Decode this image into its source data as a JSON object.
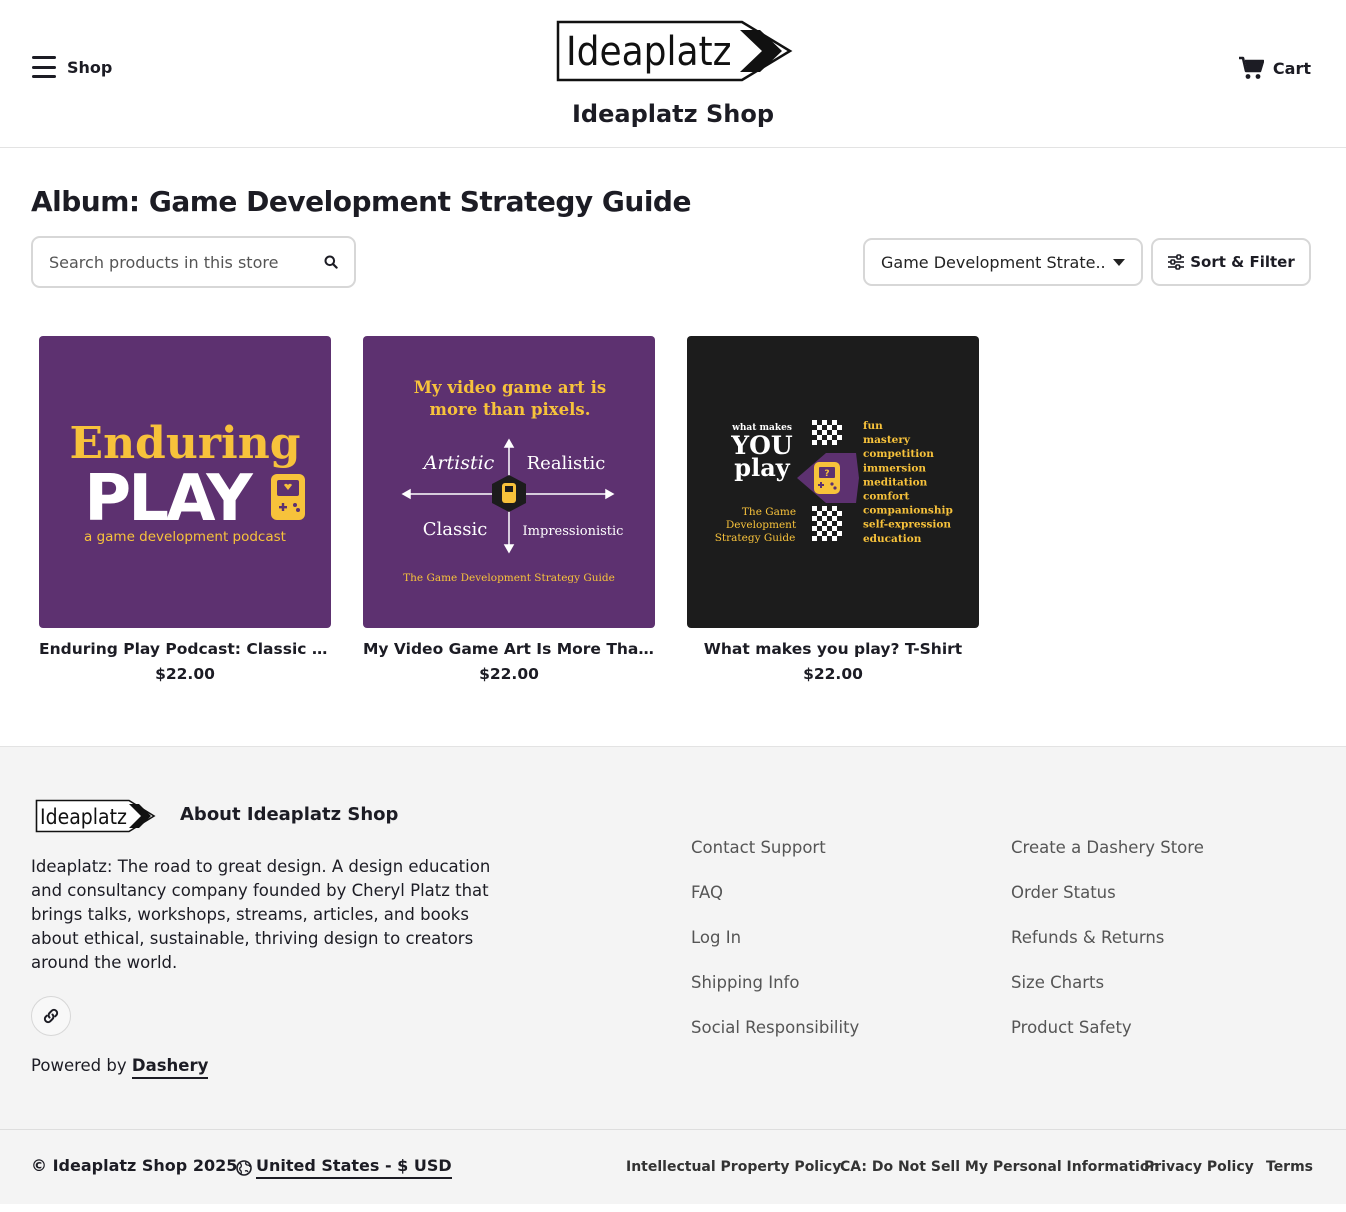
{
  "header": {
    "menu_label": "Shop",
    "logo_text": "Ideaplatz",
    "shop_title": "Ideaplatz Shop",
    "cart_label": "Cart"
  },
  "main": {
    "album_title": "Album: Game Development Strategy Guide",
    "search_placeholder": "Search products in this store",
    "album_select_value": "Game Development Strate...",
    "sort_filter_label": "Sort & Filter"
  },
  "products": [
    {
      "name": "Enduring Play Podcast: Classic Lo...",
      "price": "$22.00",
      "art": {
        "line1": "Enduring",
        "line2": "PLAY",
        "line3": "a game development podcast"
      }
    },
    {
      "name": "My Video Game Art Is More Than ...",
      "price": "$22.00",
      "art": {
        "headline1": "My video game art is",
        "headline2": "more than pixels.",
        "q_artistic": "Artistic",
        "q_realistic": "Realistic",
        "q_classic": "Classic",
        "q_impressionistic": "Impressionistic",
        "footer": "The Game Development Strategy Guide"
      }
    },
    {
      "name": "What makes you play? T-Shirt",
      "price": "$22.00",
      "art": {
        "small": "what makes",
        "you": "YOU",
        "play": "play",
        "guide1": "The Game",
        "guide2": "Development",
        "guide3": "Strategy Guide",
        "words": [
          "fun",
          "mastery",
          "competition",
          "immersion",
          "meditation",
          "comfort",
          "companionship",
          "self-expression",
          "education"
        ]
      }
    }
  ],
  "footer": {
    "logo_text": "Ideaplatz",
    "about_title": "About Ideaplatz Shop",
    "about_text": "Ideaplatz: The road to great design. A design education and consultancy company founded by Cheryl Platz that brings talks, workshops, streams, articles, and books about ethical, sustainable, thriving design to creators around the world.",
    "powered_prefix": "Powered by",
    "powered_link": "Dashery",
    "links_col1": [
      "Contact Support",
      "FAQ",
      "Log In",
      "Shipping Info",
      "Social Responsibility"
    ],
    "links_col2": [
      "Create a Dashery Store",
      "Order Status",
      "Refunds & Returns",
      "Size Charts",
      "Product Safety"
    ],
    "copyright": "© Ideaplatz Shop 2025",
    "locale": "United States - $ USD",
    "legal": [
      "Intellectual Property Policy",
      "CA: Do Not Sell My Personal Information",
      "Privacy Policy",
      "Terms"
    ]
  },
  "colors": {
    "purple": "#5d3170",
    "yellow": "#f7c23b",
    "dark": "#1c1c1c",
    "text": "#1c1c24"
  }
}
